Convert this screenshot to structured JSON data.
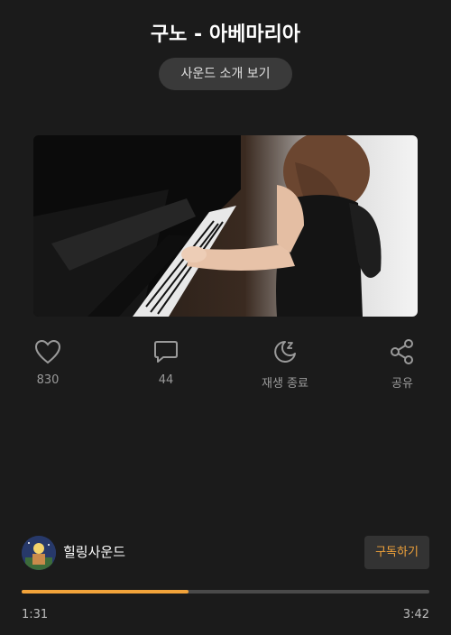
{
  "title": "구노 - 아베마리아",
  "intro_button": "사운드 소개 보기",
  "actions": [
    {
      "icon": "heart-icon",
      "label": "830"
    },
    {
      "icon": "comment-icon",
      "label": "44"
    },
    {
      "icon": "moon-sleep-icon",
      "label": "재생 종료"
    },
    {
      "icon": "share-icon",
      "label": "공유"
    }
  ],
  "channel": {
    "name": "힐링사운드",
    "subscribe_label": "구독하기"
  },
  "player": {
    "current_time": "1:31",
    "total_time": "3:42",
    "progress": 0.41
  },
  "colors": {
    "background": "#1b1b1b",
    "accent": "#f2a33a"
  }
}
